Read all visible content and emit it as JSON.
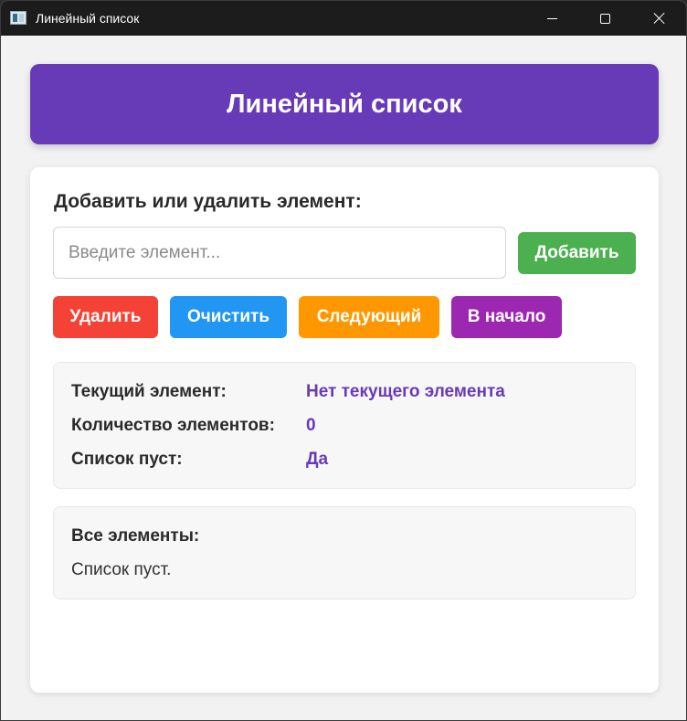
{
  "window": {
    "title": "Линейный список",
    "icon": "app-window-icon",
    "controls": {
      "minimize": "minimize-icon",
      "maximize": "maximize-icon",
      "close": "close-icon"
    }
  },
  "header": {
    "title": "Линейный список",
    "color": "#673ab7"
  },
  "form": {
    "section_label": "Добавить или удалить элемент:",
    "input_value": "",
    "input_placeholder": "Введите элемент...",
    "add_label": "Добавить"
  },
  "actions": {
    "delete_label": "Удалить",
    "clear_label": "Очистить",
    "next_label": "Следующий",
    "to_start_label": "В начало"
  },
  "colors": {
    "add": "#4caf50",
    "delete": "#f44336",
    "clear": "#2196f3",
    "next": "#ff9800",
    "to_start": "#9c27b0",
    "value_text": "#673ab7"
  },
  "info": {
    "current_label": "Текущий элемент:",
    "current_value": "Нет текущего элемента",
    "count_label": "Количество элементов:",
    "count_value": "0",
    "empty_label": "Список пуст:",
    "empty_value": "Да"
  },
  "all_elements": {
    "title": "Все элементы:",
    "text": "Список пуст."
  }
}
